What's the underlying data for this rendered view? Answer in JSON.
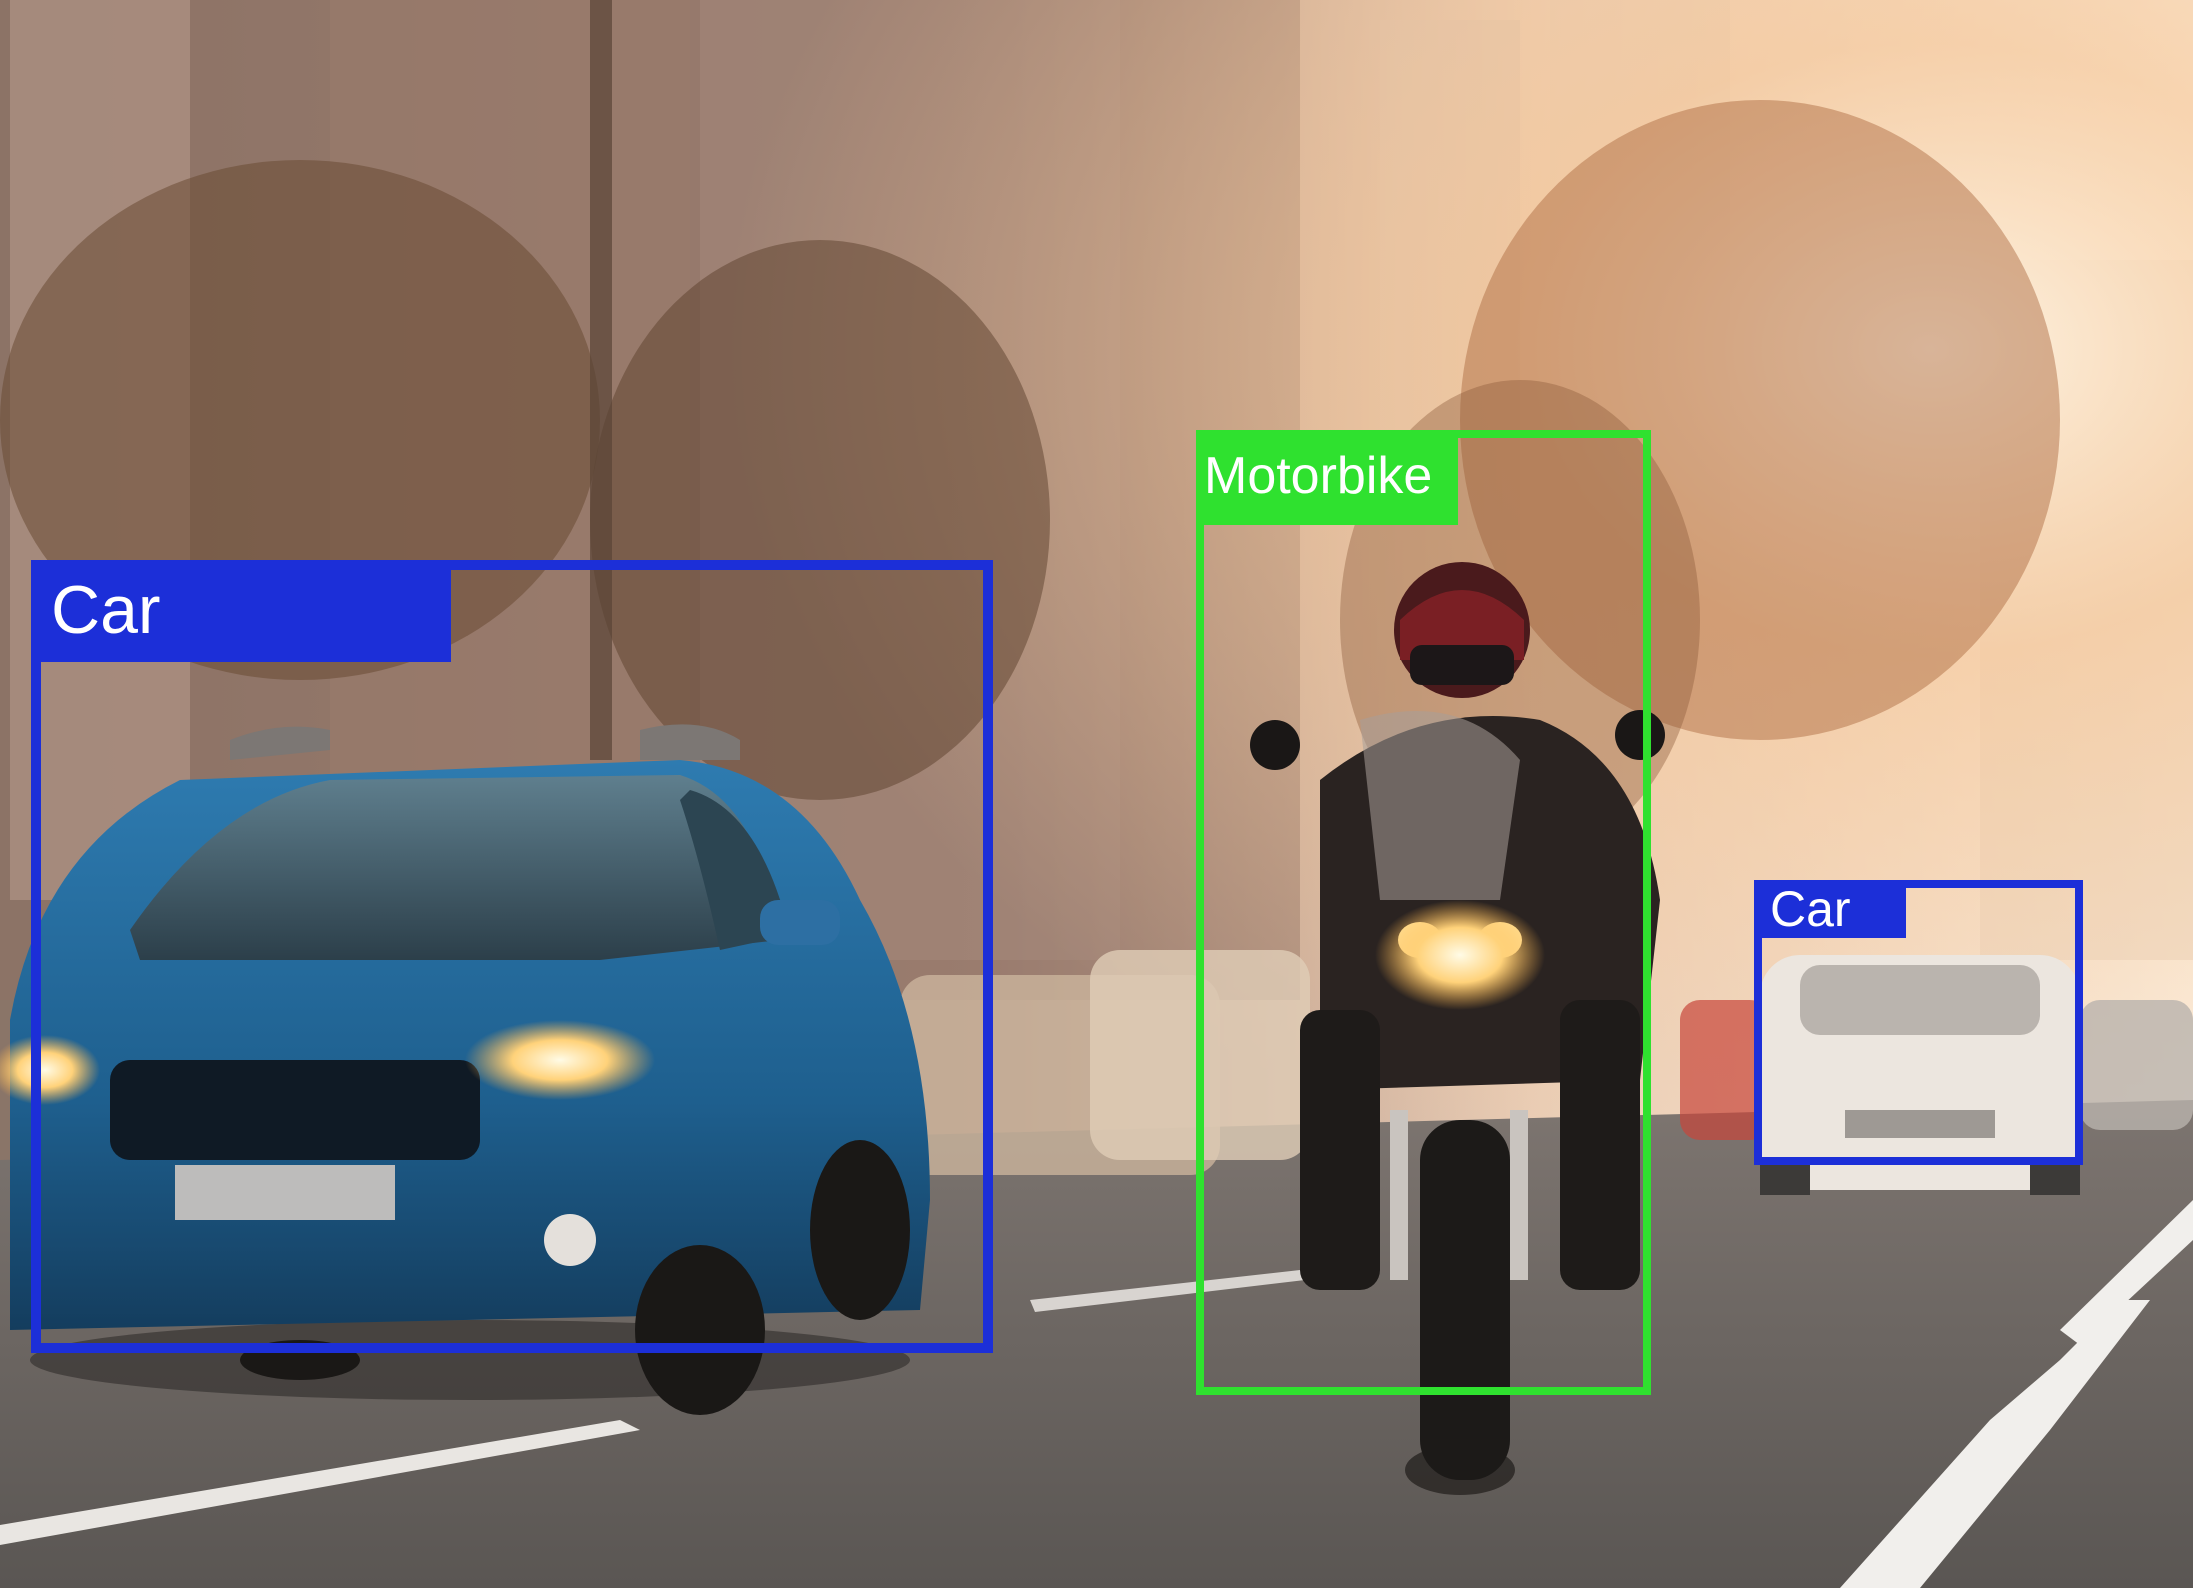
{
  "colors": {
    "car": "#1c2fd8",
    "motorbike": "#2fe12f",
    "label_text": "#ffffff"
  },
  "detections": [
    {
      "label": "Car",
      "color_key": "car"
    },
    {
      "label": "Motorbike",
      "color_key": "motorbike"
    },
    {
      "label": "Car",
      "color_key": "car"
    }
  ]
}
